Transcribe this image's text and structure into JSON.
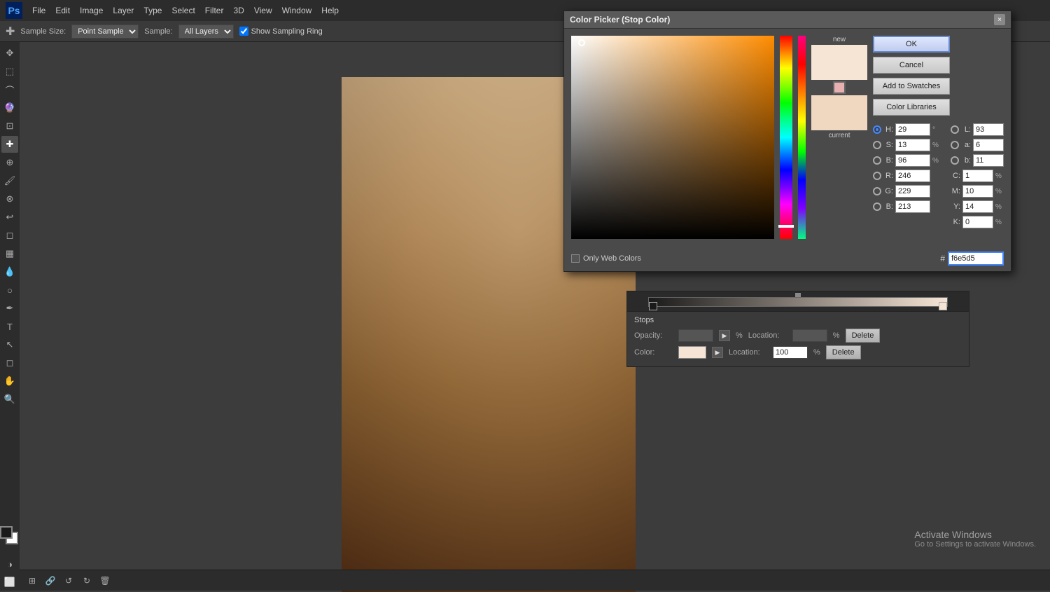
{
  "app": {
    "title": "Photoshop",
    "logo": "Ps"
  },
  "menubar": {
    "items": [
      "File",
      "Edit",
      "Image",
      "Layer",
      "Type",
      "Select",
      "Filter",
      "3D",
      "View",
      "Window",
      "Help"
    ]
  },
  "options_bar": {
    "tool_icon": "eyedropper",
    "sample_size_label": "Sample Size:",
    "sample_size_value": "Point Sample",
    "sample_label": "Sample:",
    "sample_value": "All Layers",
    "show_sampling_ring_label": "Show Sampling Ring"
  },
  "color_picker": {
    "title": "Color Picker (Stop Color)",
    "close_label": "×",
    "new_label": "new",
    "current_label": "current",
    "ok_label": "OK",
    "cancel_label": "Cancel",
    "add_to_swatches_label": "Add to Swatches",
    "color_libraries_label": "Color Libraries",
    "only_web_colors_label": "Only Web Colors",
    "hex_label": "#",
    "hex_value": "f6e5d5",
    "fields": {
      "H": {
        "value": "29",
        "unit": "°",
        "selected": true
      },
      "S": {
        "value": "13",
        "unit": "%",
        "selected": false
      },
      "B": {
        "value": "96",
        "unit": "%",
        "selected": false
      },
      "R": {
        "value": "246",
        "unit": "",
        "selected": false
      },
      "G": {
        "value": "229",
        "unit": "",
        "selected": false
      },
      "B2": {
        "value": "213",
        "unit": "",
        "selected": false
      }
    },
    "right_fields": {
      "L": {
        "value": "93",
        "unit": ""
      },
      "a": {
        "value": "6",
        "unit": ""
      },
      "b": {
        "value": "11",
        "unit": ""
      },
      "C": {
        "value": "1",
        "unit": "%"
      },
      "M": {
        "value": "10",
        "unit": "%"
      },
      "Y": {
        "value": "14",
        "unit": "%"
      },
      "K": {
        "value": "0",
        "unit": "%"
      }
    }
  },
  "gradient_editor": {
    "stops_title": "Stops",
    "opacity_label": "Opacity:",
    "opacity_location_label": "Location:",
    "opacity_pct": "%",
    "color_label": "Color:",
    "color_location_label": "Location:",
    "color_location_value": "100",
    "color_pct": "%",
    "delete_label": "Delete",
    "delete_label2": "Delete"
  },
  "activate_windows": {
    "title": "Activate Windows",
    "subtitle": "Go to Settings to activate Windows."
  },
  "bottom_bar": {
    "icons": [
      "grid",
      "link",
      "rotate-ccw",
      "rotate-cw",
      "trash"
    ]
  },
  "gradient_right": {
    "icons": [
      "grid",
      "link",
      "rotate-ccw",
      "rotate-cw",
      "trash",
      "settings"
    ]
  }
}
